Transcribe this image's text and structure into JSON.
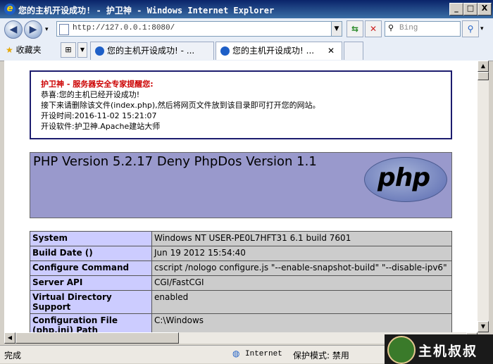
{
  "window": {
    "title": "您的主机开设成功! - 护卫神 - Windows Internet Explorer",
    "min_label": "_",
    "max_label": "□",
    "close_label": "X"
  },
  "nav": {
    "back_icon": "back-arrow-icon",
    "forward_icon": "forward-arrow-icon",
    "url": "http://127.0.0.1:8080/",
    "search_placeholder": "Bing"
  },
  "favorites": {
    "label": "收藏夹"
  },
  "tabs": [
    {
      "label": "您的主机开设成功! - ..."
    },
    {
      "label": "您的主机开设成功! ..."
    }
  ],
  "notice": {
    "heading": "护卫神 - 服务器安全专家提醒您:",
    "line1": "恭喜:您的主机已经开设成功!",
    "line2": "接下来请删除该文件(index.php),然后将网页文件放到该目录即可打开您的网站。",
    "line3": "开设时间:2016-11-02 15:21:07",
    "line4": "开设软件:护卫神.Apache建站大师"
  },
  "php": {
    "heading": "PHP Version 5.2.17 Deny PhpDos Version 1.1",
    "logo_text": "php",
    "rows": [
      {
        "key": "System",
        "value": "Windows NT USER-PE0L7HFT31 6.1 build 7601"
      },
      {
        "key": "Build Date ()",
        "value": "Jun 19 2012 15:54:40"
      },
      {
        "key": "Configure Command",
        "value": "cscript /nologo configure.js \"--enable-snapshot-build\" \"--disable-ipv6\""
      },
      {
        "key": "Server API",
        "value": "CGI/FastCGI"
      },
      {
        "key": "Virtual Directory Support",
        "value": "enabled"
      },
      {
        "key": "Configuration File (php.ini) Path",
        "value": "C:\\Windows"
      }
    ]
  },
  "status": {
    "left": "完成",
    "zone": "Internet",
    "protected_mode": "保护模式: 禁用",
    "watermark": "主机叔叔"
  }
}
